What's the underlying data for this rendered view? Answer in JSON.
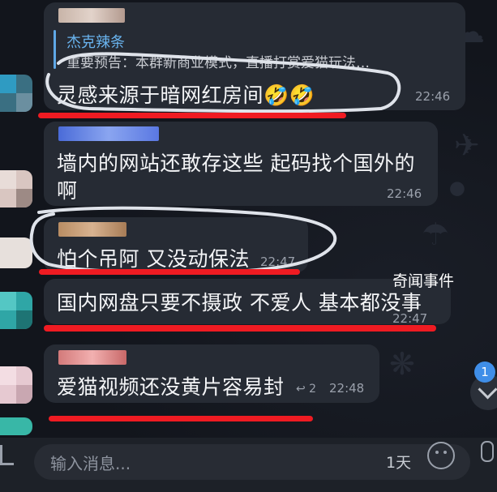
{
  "messages": [
    {
      "reply": {
        "name": "杰克辣条",
        "text": "重要预告：本群新商业模式，直播打赏爱猫玩法…"
      },
      "text": "灵感来源于暗网红房间🤣🤣",
      "time": "22:46"
    },
    {
      "text": "墙内的网站还敢存这些 起码找个国外的",
      "text2": "啊",
      "time": "22:46"
    },
    {
      "text": "怕个吊阿 又没动保法",
      "time": "22:47"
    },
    {
      "text": "国内网盘只要不摄政 不爱人 基本都没事",
      "time": "22:47"
    },
    {
      "text": "爱猫视频还没黄片容易封",
      "reply_count": "↩ 2",
      "time": "22:48"
    }
  ],
  "watermark": "奇闻事件",
  "scroll": {
    "badge": "1"
  },
  "input": {
    "placeholder": "输入消息...",
    "timer": "1天"
  },
  "icons": [
    "emoji-icon",
    "mic-icon",
    "attach-icon",
    "chevron-down-icon",
    "reply-arrow-icon"
  ],
  "colors": {
    "background": "#12151c",
    "bubble": "#262b34",
    "accent": "#69b3ee",
    "annotation_red": "#ef1b22",
    "annotation_white": "#dfe3ea"
  }
}
